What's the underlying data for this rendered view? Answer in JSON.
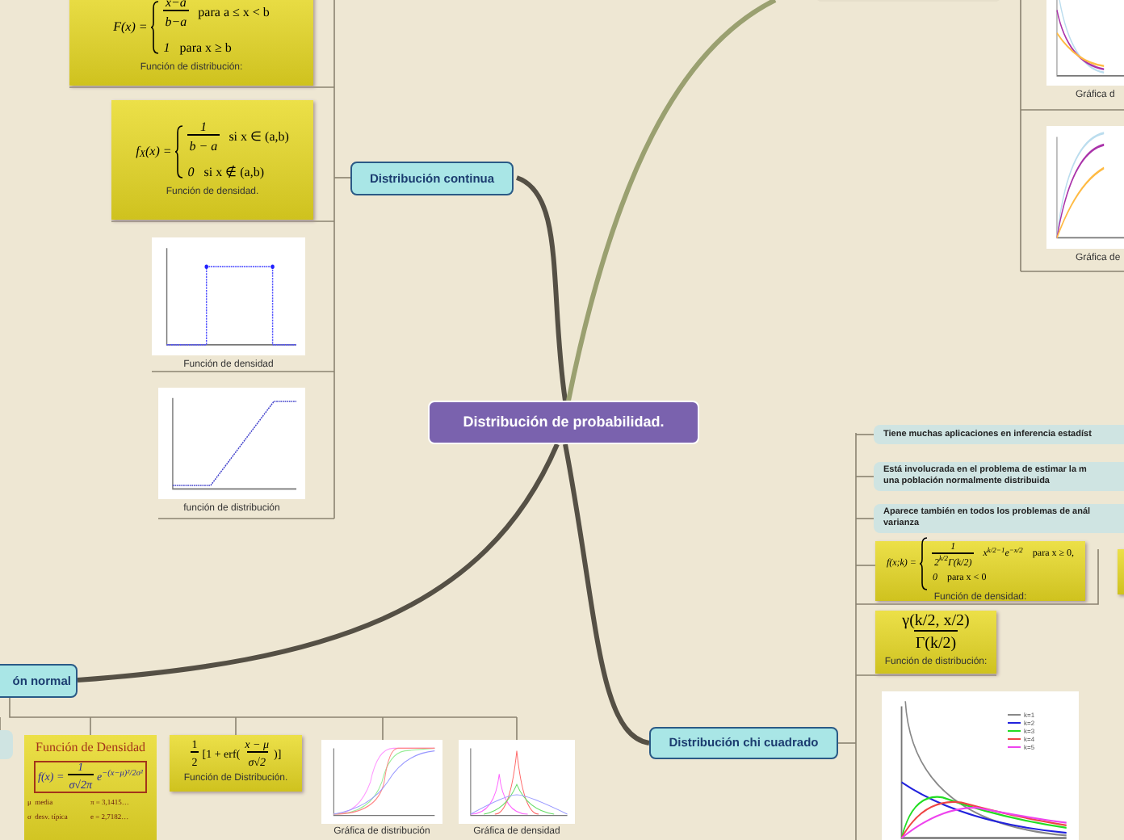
{
  "central": {
    "label": "Distribución de probabilidad."
  },
  "continua": {
    "label": "Distribución continua",
    "items": [
      {
        "kind": "piecewise",
        "lhs": "F(x) =",
        "cases": [
          {
            "num": "x−a",
            "den": "b−a",
            "cond": "para a ≤ x < b"
          },
          {
            "expr": "1",
            "cond": "para x ≥ b"
          }
        ],
        "caption": "Función de distribución:"
      },
      {
        "kind": "piecewise",
        "lhs": "f$_{X}$(x) =",
        "cases": [
          {
            "num": "1",
            "den": "b − a",
            "cond": "si x ∈ (a,b)"
          },
          {
            "expr": "0",
            "cond": "si x ∉ (a,b)"
          }
        ],
        "caption": "Función de densidad."
      },
      {
        "kind": "uniform-density",
        "caption": "Función de densidad"
      },
      {
        "kind": "uniform-cdf",
        "caption": "función de distribución"
      }
    ]
  },
  "top_right": {
    "items": [
      {
        "kind": "decay",
        "caption": "Gráfica d"
      },
      {
        "kind": "growth",
        "caption": "Gráfica de"
      }
    ]
  },
  "chi": {
    "label": "Distribución chi cuadrado",
    "notes": [
      {
        "lines": [
          "Tiene muchas aplicaciones en inferencia estadíst"
        ]
      },
      {
        "lines": [
          "Está involucrada en el problema de estimar la m",
          "una población normalmente distribuida"
        ]
      },
      {
        "lines": [
          "Aparece también en todos los problemas de anál",
          "varianza"
        ]
      }
    ],
    "density": {
      "lhs": "f(x;k) =",
      "cases": [
        {
          "num": "1",
          "den": "2$^{k/2}$Γ(k/2)",
          "tail": "x$^{k/2−1}$e$^{−x/2}$",
          "cond": "para x ≥ 0,"
        },
        {
          "expr": "0",
          "cond": "para x < 0"
        }
      ],
      "caption": "Función de densidad:"
    },
    "distribution": {
      "num": "γ(k/2, x/2)",
      "den": "Γ(k/2)",
      "caption": "Función de distribución:"
    },
    "chart": {
      "legend": [
        {
          "label": "k=1",
          "color": "#888888"
        },
        {
          "label": "k=2",
          "color": "#2222dd"
        },
        {
          "label": "k=3",
          "color": "#22dd22"
        },
        {
          "label": "k=4",
          "color": "#ee4444"
        },
        {
          "label": "k=5",
          "color": "#ee44ee"
        }
      ]
    }
  },
  "normal": {
    "label": "ón normal",
    "density": {
      "title": "Función de Densidad",
      "lhs": "f(x) =",
      "num": "1",
      "den": "σ√2π",
      "exp": "e$^{−(x−μ)²/2σ²}$",
      "cells": [
        "μ  media",
        "π = 3,1415…",
        "σ  desv. típica",
        "e = 2,7182…"
      ]
    },
    "distribution": {
      "coef_num": "1",
      "coef_den": "2",
      "pre": "[1 + erf(",
      "num": "x − μ",
      "den": "σ√2",
      "post": ")]",
      "caption": "Función de Distribución."
    },
    "charts": [
      {
        "kind": "normal-cdf",
        "caption": "Gráfica de distribución"
      },
      {
        "kind": "normal-pdf",
        "caption": "Gráfica de densidad"
      }
    ]
  }
}
